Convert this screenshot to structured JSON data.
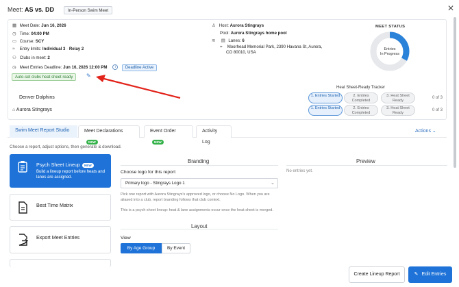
{
  "header": {
    "prefix": "Meet:",
    "meet_name": "AS vs. DD",
    "badge": "In-Person Swim Meet",
    "close_icon": "close-icon"
  },
  "summary": {
    "meet_date_label": "Meet Date:",
    "meet_date": "Jun 16, 2026",
    "time_label": "Time:",
    "time": "04:00 PM",
    "course_label": "Course:",
    "course": "SCY",
    "entry_limits_label": "Entry limits:",
    "entry_limits": "Individual 3",
    "entry_relay": "Relay 2",
    "clubs_label": "Clubs in meet:",
    "clubs": "2",
    "deadline_label": "Meet Entries Deadline:",
    "deadline": "Jun 16, 2026 12:00 PM",
    "deadline_status": "Deadline Active",
    "auto_badge": "Auto-set clubs heat sheet ready",
    "host_label": "Host:",
    "host": "Aurora Stingrays",
    "pool_label": "Pool:",
    "pool": "Aurora Stingrays home pool",
    "lanes_label": "Lanes:",
    "lanes": "6",
    "address_line1": "Moorhead Memorial Park, 2390 Havana St, Aurora,",
    "address_line2": "CO 80010, USA"
  },
  "status": {
    "title": "MEET STATUS",
    "line1": "Entries",
    "line2": "In Progress",
    "progress_fraction": 0.33,
    "accent": "#2b82d9",
    "track": "#e6e8eb"
  },
  "tracker": {
    "title": "Heat Sheet-Ready Tracker",
    "teams": [
      {
        "name": "Denver Dolphins",
        "steps": [
          "1. Entries Started",
          "2. Entries Completed",
          "3. Heat Sheet Ready"
        ],
        "count": "0 of 3"
      },
      {
        "name": "Aurora Stingrays",
        "steps": [
          "1. Entries Started",
          "2. Entries Completed",
          "3. Heat Sheet Ready"
        ],
        "count": "0 of 3"
      }
    ]
  },
  "tabs": {
    "items": [
      {
        "label": "Swim Meet Report Studio"
      },
      {
        "label": "Meet Declarations",
        "badge": "NEW"
      },
      {
        "label": "Event Order",
        "badge": "NEW"
      },
      {
        "label": "Activity Log"
      }
    ],
    "actions": "Actions"
  },
  "studio": {
    "subtitle": "Choose a report, adjust options, then generate & download.",
    "cards": [
      {
        "title": "Psych Sheet Lineup",
        "badge": "NEW",
        "desc": "Build a lineup report before heats and lanes are assigned."
      },
      {
        "title": "Best Time Matrix"
      },
      {
        "title": "Export Meet Entries"
      }
    ],
    "branding_title": "Branding",
    "logo_label": "Choose logo for this report",
    "logo_value": "Primary logo - Stingrays Logo 1",
    "logo_help": "Pick from your approved logos. You can use another approved logo or choose No Logo. When you are aliased into a club, report branding follows that club context.",
    "logo_help_full": "Pick one report with Aurora Stingrays's approved logo, or choose No Logo. When you are aliased into a club, report branding follows that club context.",
    "psych_note": "This is a psych sheet lineup: heat & lane assignments occur once the heat sheet is merged.",
    "layout_title": "Layout",
    "view_label": "View",
    "view_options": [
      "By Age Group",
      "By Event"
    ],
    "preview_title": "Preview",
    "no_entries": "No entries yet."
  },
  "footer": {
    "create": "Create Lineup Report",
    "edit": "Edit Entries"
  }
}
